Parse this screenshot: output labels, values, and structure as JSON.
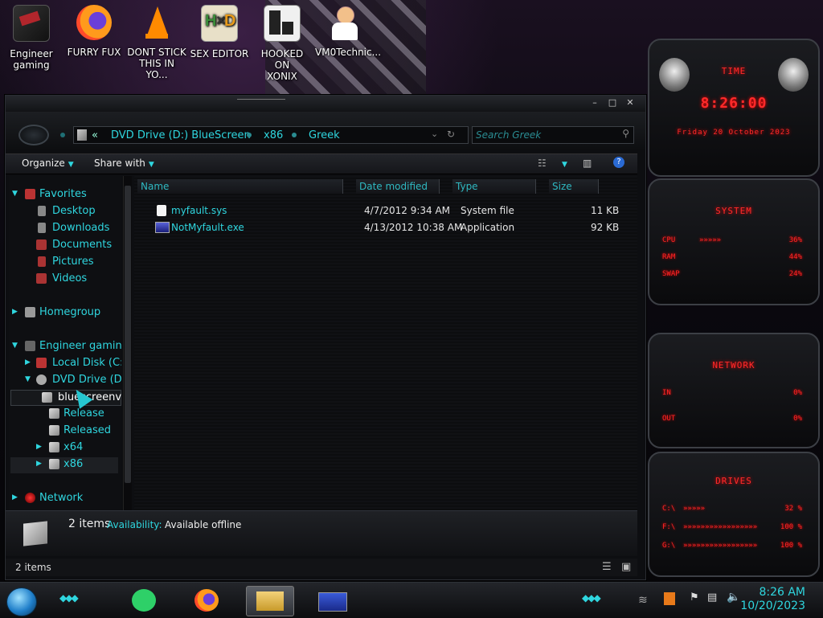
{
  "desktop": {
    "icons": [
      {
        "label": "Engineer\ngaming"
      },
      {
        "label": "FURRY FUX"
      },
      {
        "label": "DONT STICK\nTHIS IN YO..."
      },
      {
        "label": "SEX EDITOR"
      },
      {
        "label": "HOOKED ON\nXONIX"
      },
      {
        "label": "VM0Technic..."
      }
    ]
  },
  "explorer": {
    "address": {
      "chevron": "«",
      "crumbs": [
        "DVD Drive (D:) BlueScreen",
        "x86",
        "Greek"
      ]
    },
    "search": {
      "placeholder": "Search Greek"
    },
    "toolbar": {
      "organize": "Organize",
      "share_with": "Share with"
    },
    "nav": {
      "favorites": "Favorites",
      "desktop": "Desktop",
      "downloads": "Downloads",
      "documents": "Documents",
      "pictures": "Pictures",
      "videos": "Videos",
      "homegroup": "Homegroup",
      "computer": "Engineer gaming",
      "local_disk": "Local Disk (C:)",
      "dvd_drive": "DVD Drive (D:) B",
      "bluescreenview": "bluescreenview",
      "release": "Release",
      "released": "Released",
      "x64": "x64",
      "x86": "x86",
      "network": "Network"
    },
    "columns": {
      "name": "Name",
      "date": "Date modified",
      "type": "Type",
      "size": "Size"
    },
    "files": [
      {
        "name": "myfault.sys",
        "date": "4/7/2012 9:34 AM",
        "type": "System file",
        "size": "11 KB"
      },
      {
        "name": "NotMyfault.exe",
        "date": "4/13/2012 10:38 AM",
        "type": "Application",
        "size": "92 KB"
      }
    ],
    "details": {
      "count": "2 items",
      "availability_label": "Availability:",
      "availability_value": "Available offline"
    },
    "status": "2 items"
  },
  "widgets": {
    "time": {
      "title": "TIME",
      "clock": "8:26:00",
      "date": "Friday 20 October 2023"
    },
    "system": {
      "title": "SYSTEM",
      "cpu_label": "CPU",
      "cpu": "36%",
      "ram_label": "RAM",
      "ram": "44%",
      "swap_label": "SWAP",
      "swap": "24%"
    },
    "network": {
      "title": "NETWORK",
      "in_label": "IN",
      "in": "0%",
      "out_label": "OUT",
      "out": "0%"
    },
    "drives": {
      "title": "DRIVES",
      "c_label": "C:\\",
      "c": "32 %",
      "f_label": "F:\\",
      "f": "100 %",
      "g_label": "G:\\",
      "g": "100 %"
    }
  },
  "taskbar": {
    "time": "8:26 AM",
    "date": "10/20/2023"
  }
}
